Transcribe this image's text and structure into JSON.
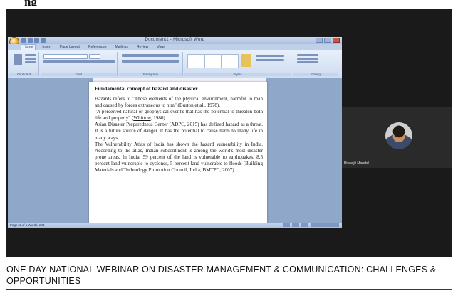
{
  "top_crop_text": "ng",
  "word_window": {
    "title": "Document1 - Microsoft Word",
    "tabs": [
      "Home",
      "Insert",
      "Page Layout",
      "References",
      "Mailings",
      "Review",
      "View"
    ],
    "ribbon_groups": [
      "Clipboard",
      "Font",
      "Paragraph",
      "Styles",
      "Editing"
    ],
    "status": "Page: 1 of 1   Words: 244"
  },
  "document": {
    "heading": "Fundamental concept of hazard and disaster",
    "p1": "Hazards refers to \"Those elements of the physical environment, harmful to man and caused by forces extraneous to him\" (Burton et al., 1978).",
    "p2_a": "\"A perceived natural or geophysical event's that has the potential to threaten both life and property\" (",
    "p2_link": "Whittow",
    "p2_b": ", 1980).",
    "p3_a": "Asian Disaster Preparedness Center (ADPC, 2015) ",
    "p3_link": "has defined hazard as a threat",
    "p3_b": ". It is a future source of danger. It has the potential to cause harm to many life in many ways.",
    "p4": "The Vulnerability Atlas of India has shown the hazard vulnerability in India. According to the atlas, Indian subcontinent is among the world's most disaster prone areas. In India, 59 percent of the land is vulnerable to earthquakes, 8.5 percent land vulnerable to cyclones, 5 percent land vulnerable to floods (Building Materials and Technology Promotion Council, India, BMTPC, 2007)"
  },
  "participant": {
    "name": "Biswajit Mandal"
  },
  "caption": "ONE DAY NATIONAL WEBINAR ON DISASTER MANAGEMENT & COMMUNICATION: CHALLENGES & OPPORTUNITIES"
}
